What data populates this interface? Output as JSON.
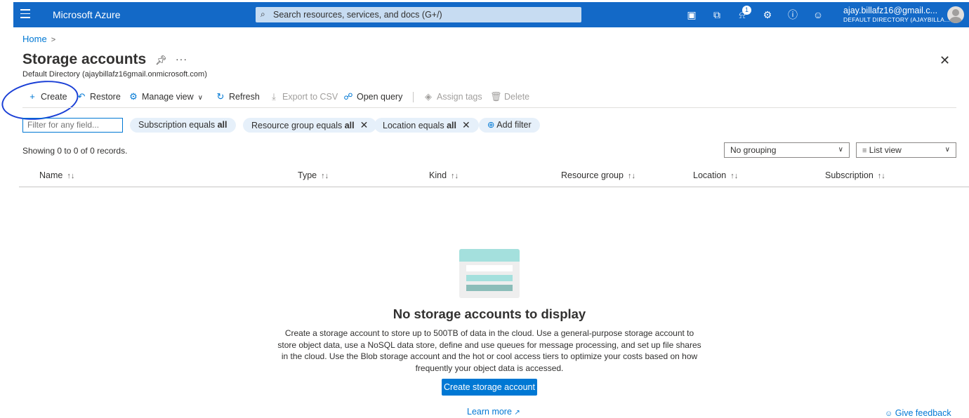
{
  "topbar": {
    "brand": "Microsoft Azure",
    "search_placeholder": "Search resources, services, and docs (G+/)",
    "notification_count": "1",
    "account_email": "ajay.billafz16@gmail.c...",
    "account_directory": "DEFAULT DIRECTORY (AJAYBILLA...",
    "icons": [
      "menu-icon",
      "cloud-shell-icon",
      "directory-filter-icon",
      "bell-icon",
      "gear-icon",
      "help-icon",
      "feedback-icon"
    ]
  },
  "breadcrumb": {
    "home": "Home",
    "sep": ">"
  },
  "page": {
    "title": "Storage accounts",
    "subtitle": "Default Directory (ajaybillafz16gmail.onmicrosoft.com)",
    "more": "···"
  },
  "toolbar": {
    "create": "Create",
    "restore": "Restore",
    "manage_view": "Manage view",
    "refresh": "Refresh",
    "export_csv": "Export to CSV",
    "open_query": "Open query",
    "assign_tags": "Assign tags",
    "delete": "Delete"
  },
  "filters": {
    "placeholder": "Filter for any field...",
    "subscription_prefix": "Subscription equals",
    "subscription_value": "all",
    "resource_group_prefix": "Resource group equals",
    "resource_group_value": "all",
    "location_prefix": "Location equals",
    "location_value": "all",
    "add_filter": "Add filter"
  },
  "records": "Showing 0 to 0 of 0 records.",
  "grouping": {
    "selected": "No grouping"
  },
  "view": {
    "selected": "List view"
  },
  "columns": [
    "Name",
    "Type",
    "Kind",
    "Resource group",
    "Location",
    "Subscription"
  ],
  "empty": {
    "title": "No storage accounts to display",
    "description": "Create a storage account to store up to 500TB of data in the cloud. Use a general-purpose storage account to store object data, use a NoSQL data store, define and use queues for message processing, and set up file shares in the cloud. Use the Blob storage account and the hot or cool access tiers to optimize your costs based on how frequently your object data is accessed.",
    "cta": "Create storage account",
    "learn_more": "Learn more"
  },
  "feedback": "Give feedback",
  "colors": {
    "azure_blue": "#1369c7",
    "link": "#0078d4",
    "annotation": "#1a3fd6"
  }
}
